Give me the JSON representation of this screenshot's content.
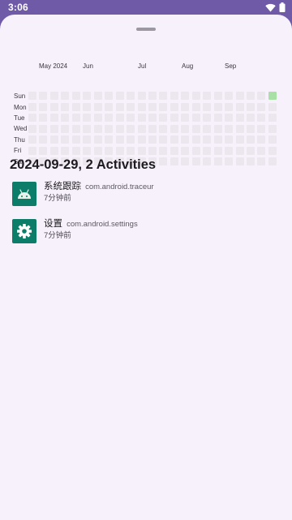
{
  "status_bar": {
    "time": "3:06",
    "icons": [
      "wifi-icon",
      "battery-icon"
    ]
  },
  "heatmap": {
    "months": [
      "May 2024",
      "Jun",
      "Jul",
      "Aug",
      "Sep"
    ],
    "days": [
      "Sun",
      "Mon",
      "Tue",
      "Wed",
      "Thu",
      "Fri",
      "Sat"
    ],
    "weeks": 23,
    "active_cells": [
      {
        "week": 22,
        "day": "Sun"
      }
    ],
    "colors": {
      "empty": "#ece7ee",
      "active": "#a8e0a6"
    }
  },
  "day_summary": {
    "title": "2024-09-29, 2 Activities"
  },
  "activities": [
    {
      "name": "系统跟踪",
      "package": "com.android.traceur",
      "time": "7分钟前",
      "icon": "android-icon",
      "icon_bg": "#0c7d68"
    },
    {
      "name": "设置",
      "package": "com.android.settings",
      "time": "7分钟前",
      "icon": "gear-icon",
      "icon_bg": "#0c7d68"
    }
  ],
  "colors": {
    "status_bar": "#6f5aa7",
    "sheet": "#f7f1fb"
  }
}
